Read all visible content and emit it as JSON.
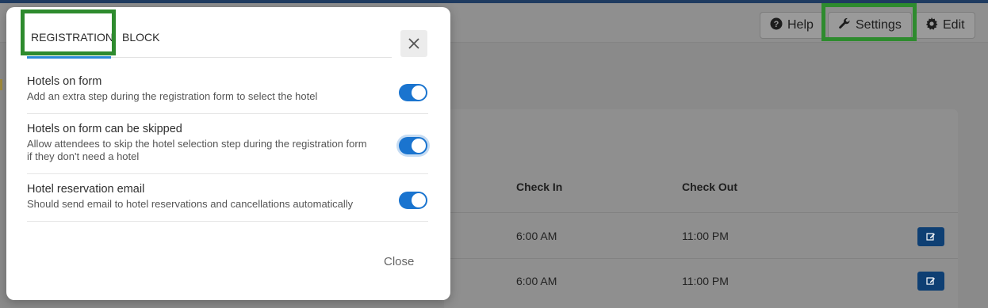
{
  "header": {
    "help_label": "Help",
    "settings_label": "Settings",
    "edit_label": "Edit"
  },
  "table": {
    "columns": [
      "Check In",
      "Check Out"
    ],
    "rows": [
      {
        "check_in": "6:00 AM",
        "check_out": "11:00 PM"
      },
      {
        "check_in": "6:00 AM",
        "check_out": "11:00 PM"
      }
    ]
  },
  "modal": {
    "tabs": [
      {
        "label": "REGISTRATION",
        "active": true
      },
      {
        "label": "BLOCK",
        "active": false
      }
    ],
    "settings": [
      {
        "title": "Hotels on form",
        "description": "Add an extra step during the registration form to select the hotel",
        "enabled": true
      },
      {
        "title": "Hotels on form can be skipped",
        "description": "Allow attendees to skip the hotel selection step during the registration form if they don't need a hotel",
        "enabled": true
      },
      {
        "title": "Hotel reservation email",
        "description": "Should send email to hotel reservations and cancellations automatically",
        "enabled": true
      }
    ],
    "close_label": "Close"
  },
  "colors": {
    "accent": "#1a74cf",
    "highlight": "#2e8b2e",
    "edit_button": "#0e3f73"
  }
}
